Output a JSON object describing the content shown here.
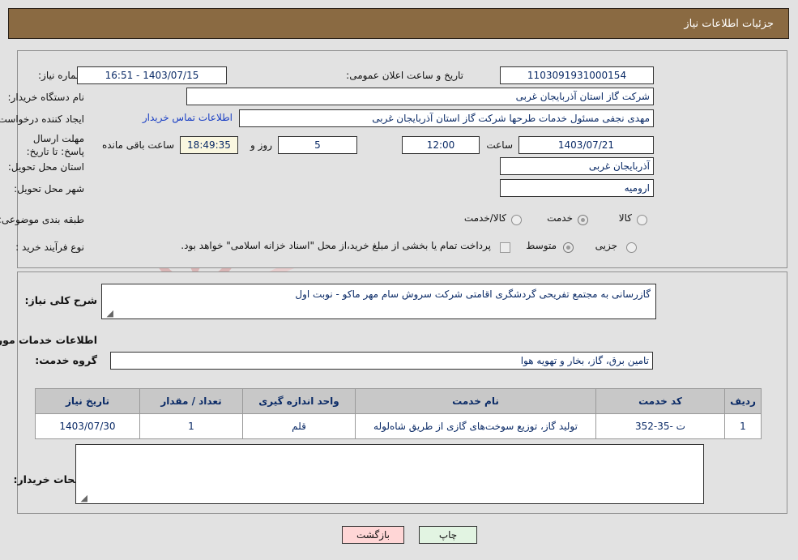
{
  "header": {
    "title": "جزئیات اطلاعات نیاز"
  },
  "form": {
    "need_number_label": "شماره نیاز:",
    "need_number_value": "1103091931000154",
    "announce_datetime_label": "تاریخ و ساعت اعلان عمومی:",
    "announce_datetime_value": "1403/07/15 - 16:51",
    "buyer_org_label": "نام دستگاه خریدار:",
    "buyer_org_value": "شرکت گاز استان آذربایجان غربی",
    "creator_label": "ایجاد کننده درخواست:",
    "creator_value": "مهدی نجفی مسئول خدمات طرحها شرکت گاز استان آذربایجان غربی",
    "buyer_contact_link": "اطلاعات تماس خریدار",
    "deadline_label": "مهلت ارسال پاسخ: تا تاریخ:",
    "deadline_date": "1403/07/21",
    "deadline_hour_label": "ساعت",
    "deadline_hour_value": "12:00",
    "days_remaining": "5",
    "days_unit_label": "روز و",
    "time_remaining": "18:49:35",
    "time_remaining_suffix": "ساعت باقی مانده",
    "province_label": "استان محل تحویل:",
    "province_value": "آذربایجان غربی",
    "city_label": "شهر محل تحویل:",
    "city_value": "ارومیه",
    "category_label": "طبقه بندی موضوعی:",
    "category_options": [
      "کالا",
      "خدمت",
      "کالا/خدمت"
    ],
    "category_selected": "خدمت",
    "process_label": "نوع فرآیند خرید :",
    "process_options": [
      "جزیی",
      "متوسط"
    ],
    "process_selected": "متوسط",
    "treasury_checkbox_label": "پرداخت تمام یا بخشی از مبلغ خرید،از محل \"اسناد خزانه اسلامی\" خواهد بود.",
    "treasury_checked": false
  },
  "details": {
    "summary_label": "شرح کلی نیاز:",
    "summary_value": "گازرسانی به مجتمع تفریحی گردشگری اقامتی شرکت سروش سام مهر ماکو - نوبت اول",
    "services_section_title": "اطلاعات خدمات مورد نیاز",
    "service_group_label": "گروه خدمت:",
    "service_group_value": "تامین برق، گاز، بخار و تهویه هوا",
    "buyer_notes_label": "توضیحات خریدار:",
    "buyer_notes_value": ""
  },
  "table": {
    "columns": [
      "ردیف",
      "کد خدمت",
      "نام خدمت",
      "واحد اندازه گیری",
      "تعداد / مقدار",
      "تاریخ نیاز"
    ],
    "rows": [
      {
        "row_no": "1",
        "service_code": "ت -35-352",
        "service_name": "تولید گاز، توزیع سوخت‌های گازی از طریق شاه‌لوله",
        "unit": "قلم",
        "quantity": "1",
        "need_date": "1403/07/30"
      }
    ]
  },
  "footer": {
    "back_label": "بازگشت",
    "print_label": "چاپ"
  },
  "watermark": {
    "text": "AriaTender.net"
  },
  "colors": {
    "header_bg": "#8a6a42",
    "page_bg": "#e2e2e2",
    "field_text": "#0a2a66",
    "link": "#1a3fc4",
    "table_header_bg": "#c8c8c8",
    "back_button_bg": "#ffd6d6",
    "print_button_bg": "#e2f4e2",
    "countdown_bg": "#faf7e0"
  }
}
